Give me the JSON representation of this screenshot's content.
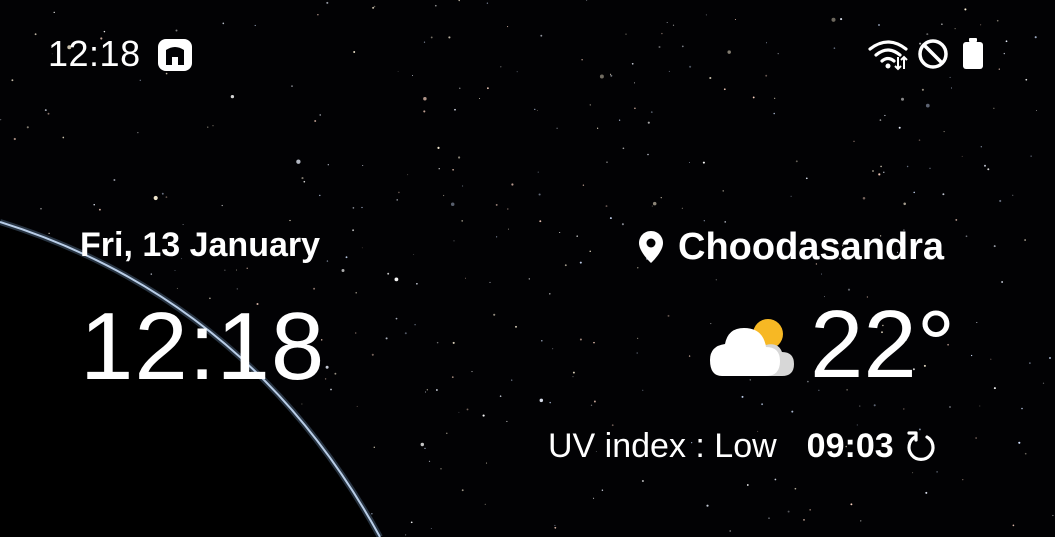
{
  "status_bar": {
    "time": "12:18",
    "icons": [
      "notification-app-icon",
      "wifi-icon",
      "do-not-disturb-icon",
      "battery-icon"
    ]
  },
  "lock_screen": {
    "date": "Fri, 13 January",
    "clock": "12:18"
  },
  "weather": {
    "location": "Choodasandra",
    "location_icon": "location-pin-icon",
    "condition_icon": "partly-cloudy-icon",
    "temperature": "22°",
    "uv": "UV index : Low",
    "updated_time": "09:03",
    "refresh_icon": "refresh-icon"
  },
  "colors": {
    "background": "#020204",
    "text": "#ffffff",
    "sun": "#f7b824",
    "planet_rim": "#a9c8e6"
  }
}
